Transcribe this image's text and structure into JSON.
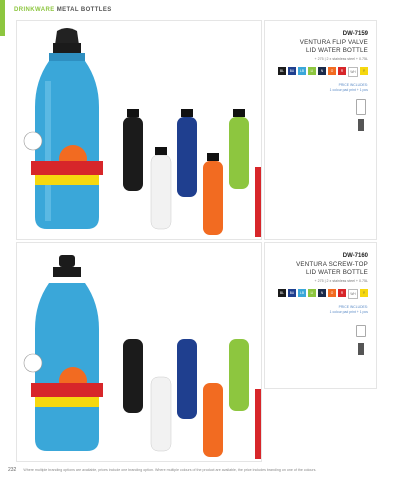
{
  "header": {
    "category": "DRINKWARE",
    "subcategory": "METAL BOTTLES"
  },
  "products": [
    {
      "code": "DW-7159",
      "title_line1": "VENTURA FLIP VALVE",
      "title_line2": "LID WATER BOTTLE",
      "spec": "+ 275 | 2 x stainless steel + 0.75L",
      "colors": [
        {
          "label": "BL",
          "hex": "#1b1b1b"
        },
        {
          "label": "BU",
          "hex": "#1f3f8f"
        },
        {
          "label": "LB",
          "hex": "#3aa7d9"
        },
        {
          "label": "LI",
          "hex": "#8dc63f"
        },
        {
          "label": "N",
          "hex": "#1a2a4a"
        },
        {
          "label": "O",
          "hex": "#f26b21"
        },
        {
          "label": "R",
          "hex": "#d7262a"
        },
        {
          "label": "WH",
          "hex": "#ffffff"
        },
        {
          "label": "Y",
          "hex": "#f6d80f"
        }
      ],
      "pricing_line1": "PRICE INCLUDES:",
      "pricing_line2": "1 colour pad print + 1 pos",
      "badge": "BPA FREE",
      "logo_top": "100",
      "logo_fm": "FM",
      "logo_brand": "ROCKFORD'S",
      "logo_tag": "GREATEST HITS"
    },
    {
      "code": "DW-7160",
      "title_line1": "VENTURA SCREW-TOP",
      "title_line2": "LID WATER BOTTLE",
      "spec": "+ 275 | 2 x stainless steel + 0.75L",
      "colors": [
        {
          "label": "BL",
          "hex": "#1b1b1b"
        },
        {
          "label": "BU",
          "hex": "#1f3f8f"
        },
        {
          "label": "LB",
          "hex": "#3aa7d9"
        },
        {
          "label": "LI",
          "hex": "#8dc63f"
        },
        {
          "label": "N",
          "hex": "#1a2a4a"
        },
        {
          "label": "O",
          "hex": "#f26b21"
        },
        {
          "label": "R",
          "hex": "#d7262a"
        },
        {
          "label": "WH",
          "hex": "#ffffff"
        },
        {
          "label": "Y",
          "hex": "#f6d80f"
        }
      ],
      "pricing_line1": "PRICE INCLUDES:",
      "pricing_line2": "1 colour pad print + 1 pos",
      "badge": "BPA FREE",
      "logo_top": "100",
      "logo_fm": "FM",
      "logo_brand": "ROCKFORD'S",
      "logo_tag": "GREATEST HITS"
    }
  ],
  "footer": {
    "page": "232",
    "note": "Where multiple branding options are available, prices include one branding option. Where multiple colours of the product are available, the price includes branding on one of the colours."
  },
  "bottle_colors": {
    "blue": "#3aa7d9",
    "black": "#1b1b1b",
    "white": "#f2f2f2",
    "royal": "#1f3f8f",
    "orange": "#f26b21",
    "lime": "#8dc63f",
    "red": "#d7262a",
    "navy": "#1a2a4a",
    "yellow": "#f6d80f"
  }
}
